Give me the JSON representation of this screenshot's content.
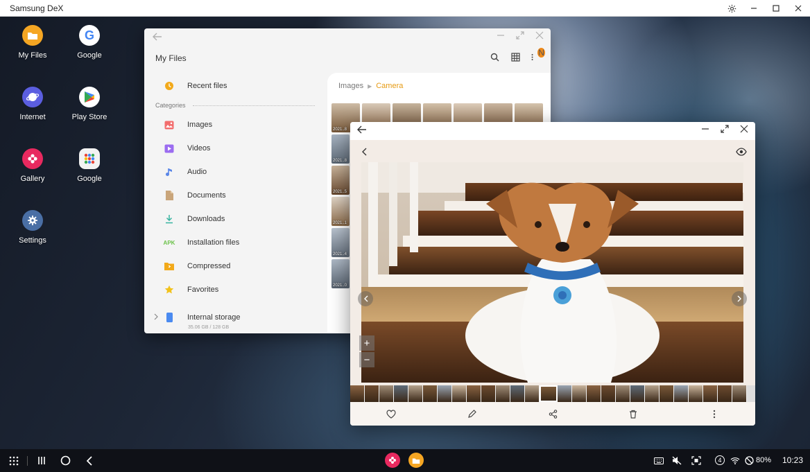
{
  "dex": {
    "title": "Samsung DeX"
  },
  "desktop": {
    "icons": [
      {
        "label": "My Files",
        "icon": "my-files-icon"
      },
      {
        "label": "Google",
        "icon": "google-icon"
      },
      {
        "label": "Internet",
        "icon": "internet-icon"
      },
      {
        "label": "Play Store",
        "icon": "play-store-icon"
      },
      {
        "label": "Gallery",
        "icon": "gallery-icon"
      },
      {
        "label": "Google",
        "icon": "google-folder-icon"
      },
      {
        "label": "Settings",
        "icon": "settings-icon"
      }
    ]
  },
  "myfiles": {
    "title": "My Files",
    "notification_badge": "N",
    "recent": "Recent files",
    "categories_heading": "Categories",
    "categories": [
      {
        "label": "Images",
        "color": "#f26d6d"
      },
      {
        "label": "Videos",
        "color": "#9b6cf0"
      },
      {
        "label": "Audio",
        "color": "#5a86e8"
      },
      {
        "label": "Documents",
        "color": "#c9a57a"
      },
      {
        "label": "Downloads",
        "color": "#36b3a0"
      },
      {
        "label": "Installation files",
        "color": "#6cc24a"
      },
      {
        "label": "Compressed",
        "color": "#f2a91a"
      },
      {
        "label": "Favorites",
        "color": "#f2c21a"
      }
    ],
    "apk_glyph": "APK",
    "storage": {
      "label": "Internal storage",
      "usage": "35.06 GB / 128 GB"
    },
    "breadcrumb": {
      "root": "Images",
      "current": "Camera"
    },
    "thumb_labels": [
      "2021..8",
      "2021..8",
      "2021..5",
      "2021..1",
      "2021..4",
      "2021..0"
    ]
  },
  "taskbar": {
    "battery": "80%",
    "time": "10:23",
    "notification_count": "4"
  },
  "colors": {
    "accent": "#e69a12",
    "taskbar": "#0f1117"
  }
}
